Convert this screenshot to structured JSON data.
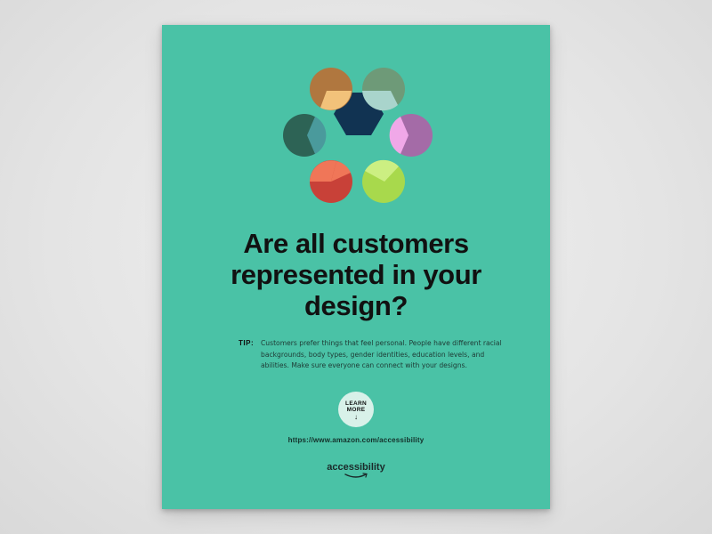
{
  "poster": {
    "headline_lines": [
      "Are all customers",
      "represented in your",
      "design?"
    ],
    "tip_label": "TIP:",
    "tip_lines": [
      "Customers prefer things that feel personal. People have different racial",
      "backgrounds, body types, gender identities, education levels, and",
      "abilities. Make sure everyone can connect with your designs."
    ],
    "learn_more": {
      "line1": "LEARN",
      "line2": "MORE",
      "arrow": "↓"
    },
    "url": "https://www.amazon.com/accessibility",
    "brand": "accessibility"
  },
  "colors": {
    "background": "#e6e6e6",
    "poster": "#4ac2a6",
    "hexagon": "#113352",
    "circle_top_left": [
      "#b0773f",
      "#f2c27a"
    ],
    "circle_top_right": [
      "#6e9a78",
      "#a9d4cc"
    ],
    "circle_left": [
      "#2d6355",
      "#4a9a9c"
    ],
    "circle_right": [
      "#a46ba7",
      "#f0a8e8"
    ],
    "circle_bottom_left": [
      "#c84138",
      "#f07658"
    ],
    "circle_bottom_right": [
      "#a8d94c",
      "#ccef82"
    ]
  }
}
